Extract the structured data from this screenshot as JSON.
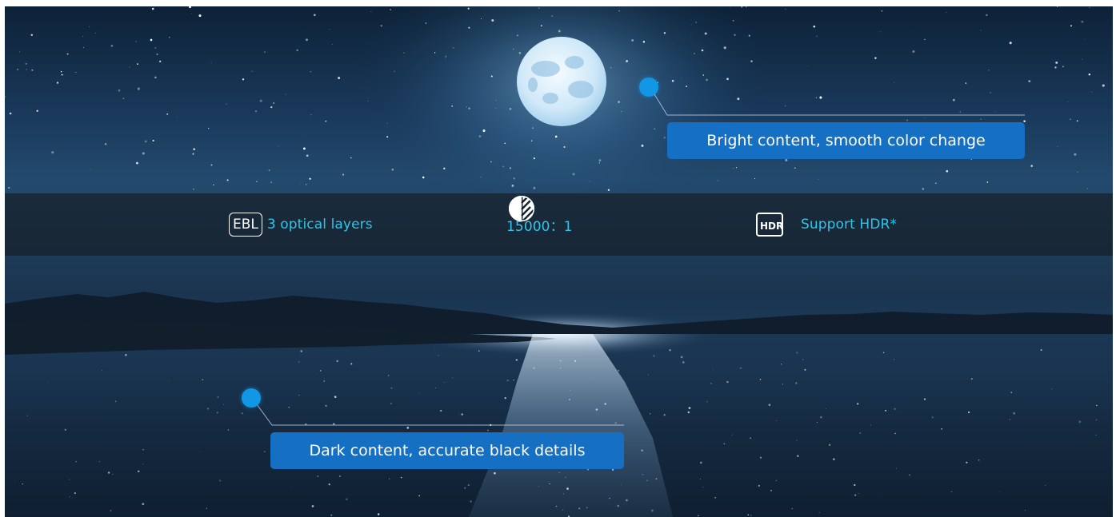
{
  "features": [
    {
      "icon": "ebl-icon",
      "badge": "EBL",
      "label": "3 optical layers"
    },
    {
      "icon": "contrast-icon",
      "label": "15000：1"
    },
    {
      "icon": "hdr-icon",
      "badge": "HDR",
      "label": "Support HDR*"
    }
  ],
  "callouts": {
    "bright": "Bright content, smooth color change",
    "dark": "Dark content, accurate black details"
  },
  "colors": {
    "accent_text": "#31c4ea",
    "callout_bg": "#1570c4",
    "dot": "#1296e6"
  }
}
